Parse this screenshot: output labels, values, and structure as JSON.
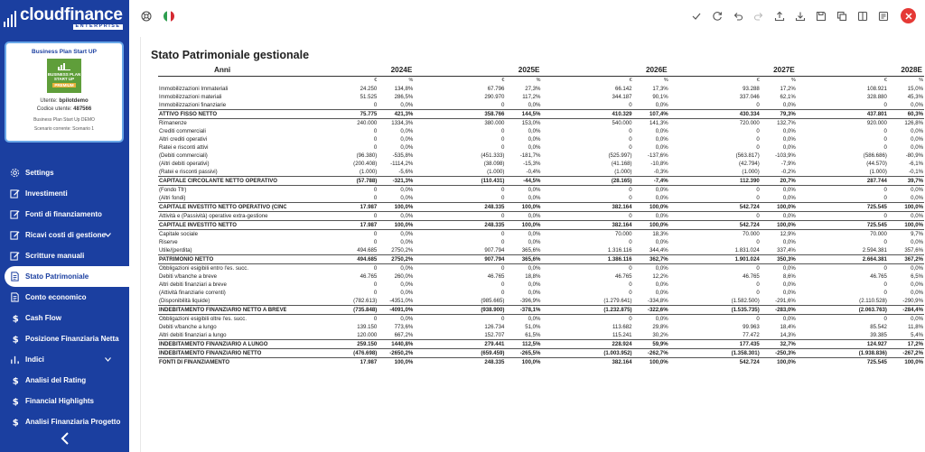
{
  "app": {
    "logo_main": "cloudfinance",
    "logo_sub": "ENTERPRISE"
  },
  "card": {
    "title": "Business Plan Start UP",
    "img_line1": "BUSINESS PLAN",
    "img_line2": "START UP",
    "img_line3": "PREMIUM",
    "user_label": "Utente:",
    "user_value": "bpilotdemo",
    "code_label": "Codice utente:",
    "code_value": "487566",
    "plan": "Business Plan Start Up DEMO",
    "scenario": "Scenario corrente: Scenario 1"
  },
  "menu": [
    {
      "label": "Settings",
      "icon": "gear-icon"
    },
    {
      "label": "Investimenti",
      "icon": "edit-icon"
    },
    {
      "label": "Fonti di finanziamento",
      "icon": "edit-icon"
    },
    {
      "label": "Ricavi costi di gestione",
      "icon": "edit-icon",
      "chevron": true
    },
    {
      "label": "Scritture manuali",
      "icon": "edit-icon"
    },
    {
      "label": "Stato Patrimoniale",
      "icon": "document-icon",
      "active": true
    },
    {
      "label": "Conto economico",
      "icon": "document-icon"
    },
    {
      "label": "Cash Flow",
      "icon": "dollar-icon"
    },
    {
      "label": "Posizione Finanziaria Netta",
      "icon": "dollar-icon"
    },
    {
      "label": "Indici",
      "icon": "bar-chart-icon",
      "chevron": true
    },
    {
      "label": "Analisi del Rating",
      "icon": "dollar-icon"
    },
    {
      "label": "Financial Highlights",
      "icon": "dollar-icon"
    },
    {
      "label": "Analisi Finanziaria Progetto",
      "icon": "dollar-icon"
    }
  ],
  "colors": {
    "sidebar": "#1b3fa0",
    "close": "#e53935",
    "card_border": "#6aa8e8"
  },
  "page": {
    "title": "Stato Patrimoniale gestionale"
  },
  "table": {
    "first_header": "Anni",
    "years": [
      "2024E",
      "2025E",
      "2026E",
      "2027E",
      "2028E"
    ],
    "unit_value": "€",
    "unit_pct": "%",
    "rows": [
      {
        "label": "Immobilizzazioni Immateriali",
        "bold": false,
        "cells": [
          "24.250",
          "134,8%",
          "67.796",
          "27,3%",
          "66.142",
          "17,3%",
          "93.288",
          "17,2%",
          "108.921",
          "15,0%"
        ]
      },
      {
        "label": "Immobilizzazioni materiali",
        "bold": false,
        "cells": [
          "51.525",
          "286,5%",
          "290.970",
          "117,2%",
          "344.187",
          "90,1%",
          "337.046",
          "62,1%",
          "328.880",
          "45,3%"
        ]
      },
      {
        "label": "Immobilizzazioni finanziarie",
        "bold": false,
        "cells": [
          "0",
          "0,0%",
          "0",
          "0,0%",
          "0",
          "0,0%",
          "0",
          "0,0%",
          "0",
          "0,0%"
        ]
      },
      {
        "label": "ATTIVO FISSO NETTO",
        "bold": true,
        "cells": [
          "75.775",
          "421,3%",
          "358.766",
          "144,5%",
          "410.329",
          "107,4%",
          "430.334",
          "79,3%",
          "437.801",
          "60,3%"
        ]
      },
      {
        "label": "Rimanenze",
        "bold": false,
        "cells": [
          "240.000",
          "1334,3%",
          "380.000",
          "153,0%",
          "540.000",
          "141,3%",
          "720.000",
          "132,7%",
          "920.000",
          "126,8%"
        ]
      },
      {
        "label": "Crediti commerciali",
        "bold": false,
        "cells": [
          "0",
          "0,0%",
          "0",
          "0,0%",
          "0",
          "0,0%",
          "0",
          "0,0%",
          "0",
          "0,0%"
        ]
      },
      {
        "label": "Altri crediti operativi",
        "bold": false,
        "cells": [
          "0",
          "0,0%",
          "0",
          "0,0%",
          "0",
          "0,0%",
          "0",
          "0,0%",
          "0",
          "0,0%"
        ]
      },
      {
        "label": "Ratei e risconti attivi",
        "bold": false,
        "cells": [
          "0",
          "0,0%",
          "0",
          "0,0%",
          "0",
          "0,0%",
          "0",
          "0,0%",
          "0",
          "0,0%"
        ]
      },
      {
        "label": "(Debiti commerciali)",
        "bold": false,
        "cells": [
          "(96.380)",
          "-535,8%",
          "(451.333)",
          "-181,7%",
          "(525.997)",
          "-137,6%",
          "(563.817)",
          "-103,9%",
          "(586.686)",
          "-80,9%"
        ]
      },
      {
        "label": "(Altri debiti operativi)",
        "bold": false,
        "cells": [
          "(200.408)",
          "-1114,2%",
          "(38.098)",
          "-15,3%",
          "(41.168)",
          "-10,8%",
          "(42.794)",
          "-7,9%",
          "(44.570)",
          "-6,1%"
        ]
      },
      {
        "label": "(Ratei e risconti passivi)",
        "bold": false,
        "cells": [
          "(1.000)",
          "-5,6%",
          "(1.000)",
          "-0,4%",
          "(1.000)",
          "-0,3%",
          "(1.000)",
          "-0,2%",
          "(1.000)",
          "-0,1%"
        ]
      },
      {
        "label": "CAPITALE CIRCOLANTE NETTO OPERATIVO",
        "bold": true,
        "cells": [
          "(57.788)",
          "-321,3%",
          "(110.431)",
          "-44,5%",
          "(28.165)",
          "-7,4%",
          "112.390",
          "20,7%",
          "287.744",
          "39,7%"
        ]
      },
      {
        "label": "(Fondo Tfr)",
        "bold": false,
        "cells": [
          "0",
          "0,0%",
          "0",
          "0,0%",
          "0",
          "0,0%",
          "0",
          "0,0%",
          "0",
          "0,0%"
        ]
      },
      {
        "label": "(Altri fondi)",
        "bold": false,
        "cells": [
          "0",
          "0,0%",
          "0",
          "0,0%",
          "0",
          "0,0%",
          "0",
          "0,0%",
          "0",
          "0,0%"
        ]
      },
      {
        "label": "CAPITALE INVESTITO NETTO OPERATIVO (CINO)",
        "bold": true,
        "cells": [
          "17.987",
          "100,0%",
          "248.335",
          "100,0%",
          "382.164",
          "100,0%",
          "542.724",
          "100,0%",
          "725.545",
          "100,0%"
        ]
      },
      {
        "label": "Attività e (Passività) operative extra-gestione",
        "bold": false,
        "cells": [
          "0",
          "0,0%",
          "0",
          "0,0%",
          "0",
          "0,0%",
          "0",
          "0,0%",
          "0",
          "0,0%"
        ]
      },
      {
        "label": "CAPITALE INVESTITO NETTO",
        "bold": true,
        "cells": [
          "17.987",
          "100,0%",
          "248.335",
          "100,0%",
          "382.164",
          "100,0%",
          "542.724",
          "100,0%",
          "725.545",
          "100,0%"
        ]
      },
      {
        "label": "Capitale sociale",
        "bold": false,
        "cells": [
          "0",
          "0,0%",
          "0",
          "0,0%",
          "70.000",
          "18,3%",
          "70.000",
          "12,9%",
          "70.000",
          "9,7%"
        ]
      },
      {
        "label": "Riserve",
        "bold": false,
        "cells": [
          "0",
          "0,0%",
          "0",
          "0,0%",
          "0",
          "0,0%",
          "0",
          "0,0%",
          "0",
          "0,0%"
        ]
      },
      {
        "label": "Utile/(perdita)",
        "bold": false,
        "cells": [
          "494.685",
          "2750,2%",
          "907.794",
          "365,6%",
          "1.316.116",
          "344,4%",
          "1.831.024",
          "337,4%",
          "2.594.381",
          "357,6%"
        ]
      },
      {
        "label": "PATRIMONIO NETTO",
        "bold": true,
        "cells": [
          "494.685",
          "2750,2%",
          "907.794",
          "365,6%",
          "1.386.116",
          "362,7%",
          "1.901.024",
          "350,3%",
          "2.664.381",
          "367,2%"
        ]
      },
      {
        "label": "Obbligazioni esigibili entro l'es. succ.",
        "bold": false,
        "cells": [
          "0",
          "0,0%",
          "0",
          "0,0%",
          "0",
          "0,0%",
          "0",
          "0,0%",
          "0",
          "0,0%"
        ]
      },
      {
        "label": "Debiti v/banche a breve",
        "bold": false,
        "cells": [
          "46.765",
          "260,0%",
          "46.765",
          "18,8%",
          "46.765",
          "12,2%",
          "46.765",
          "8,6%",
          "46.765",
          "6,5%"
        ]
      },
      {
        "label": "Altri debiti finanziari a breve",
        "bold": false,
        "cells": [
          "0",
          "0,0%",
          "0",
          "0,0%",
          "0",
          "0,0%",
          "0",
          "0,0%",
          "0",
          "0,0%"
        ]
      },
      {
        "label": "(Attività finanziarie correnti)",
        "bold": false,
        "cells": [
          "0",
          "0,0%",
          "0",
          "0,0%",
          "0",
          "0,0%",
          "0",
          "0,0%",
          "0",
          "0,0%"
        ]
      },
      {
        "label": "(Disponibilità liquide)",
        "bold": false,
        "cells": [
          "(782.613)",
          "-4351,0%",
          "(985.665)",
          "-396,9%",
          "(1.279.641)",
          "-334,8%",
          "(1.582.500)",
          "-291,6%",
          "(2.110.528)",
          "-290,9%"
        ]
      },
      {
        "label": "INDEBITAMENTO FINANZIARIO NETTO A BREVE",
        "bold": true,
        "cells": [
          "(735.848)",
          "-4091,0%",
          "(938.900)",
          "-378,1%",
          "(1.232.875)",
          "-322,6%",
          "(1.535.735)",
          "-283,0%",
          "(2.063.763)",
          "-284,4%"
        ]
      },
      {
        "label": "Obbligazioni esigibili oltre l'es. succ.",
        "bold": false,
        "cells": [
          "0",
          "0,0%",
          "0",
          "0,0%",
          "0",
          "0,0%",
          "0",
          "0,0%",
          "0",
          "0,0%"
        ]
      },
      {
        "label": "Debiti v/banche a lungo",
        "bold": false,
        "cells": [
          "139.150",
          "773,6%",
          "126.734",
          "51,0%",
          "113.682",
          "29,8%",
          "99.963",
          "18,4%",
          "85.542",
          "11,8%"
        ]
      },
      {
        "label": "Altri debiti finanziari a lungo",
        "bold": false,
        "cells": [
          "120.000",
          "667,2%",
          "152.707",
          "61,5%",
          "115.241",
          "30,2%",
          "77.472",
          "14,3%",
          "39.385",
          "5,4%"
        ]
      },
      {
        "label": "INDEBITAMENTO FINANZIARIO A LUNGO",
        "bold": true,
        "cells": [
          "259.150",
          "1440,8%",
          "279.441",
          "112,5%",
          "228.924",
          "59,9%",
          "177.435",
          "32,7%",
          "124.927",
          "17,2%"
        ]
      },
      {
        "label": "INDEBITAMENTO FINANZIARIO NETTO",
        "bold": true,
        "cells": [
          "(476.698)",
          "-2650,2%",
          "(659.459)",
          "-265,5%",
          "(1.003.952)",
          "-262,7%",
          "(1.358.301)",
          "-250,3%",
          "(1.938.836)",
          "-267,2%"
        ]
      },
      {
        "label": "FONTI DI FINANZIAMENTO",
        "bold": true,
        "cells": [
          "17.987",
          "100,0%",
          "248.335",
          "100,0%",
          "382.164",
          "100,0%",
          "542.724",
          "100,0%",
          "725.545",
          "100,0%"
        ]
      }
    ]
  }
}
